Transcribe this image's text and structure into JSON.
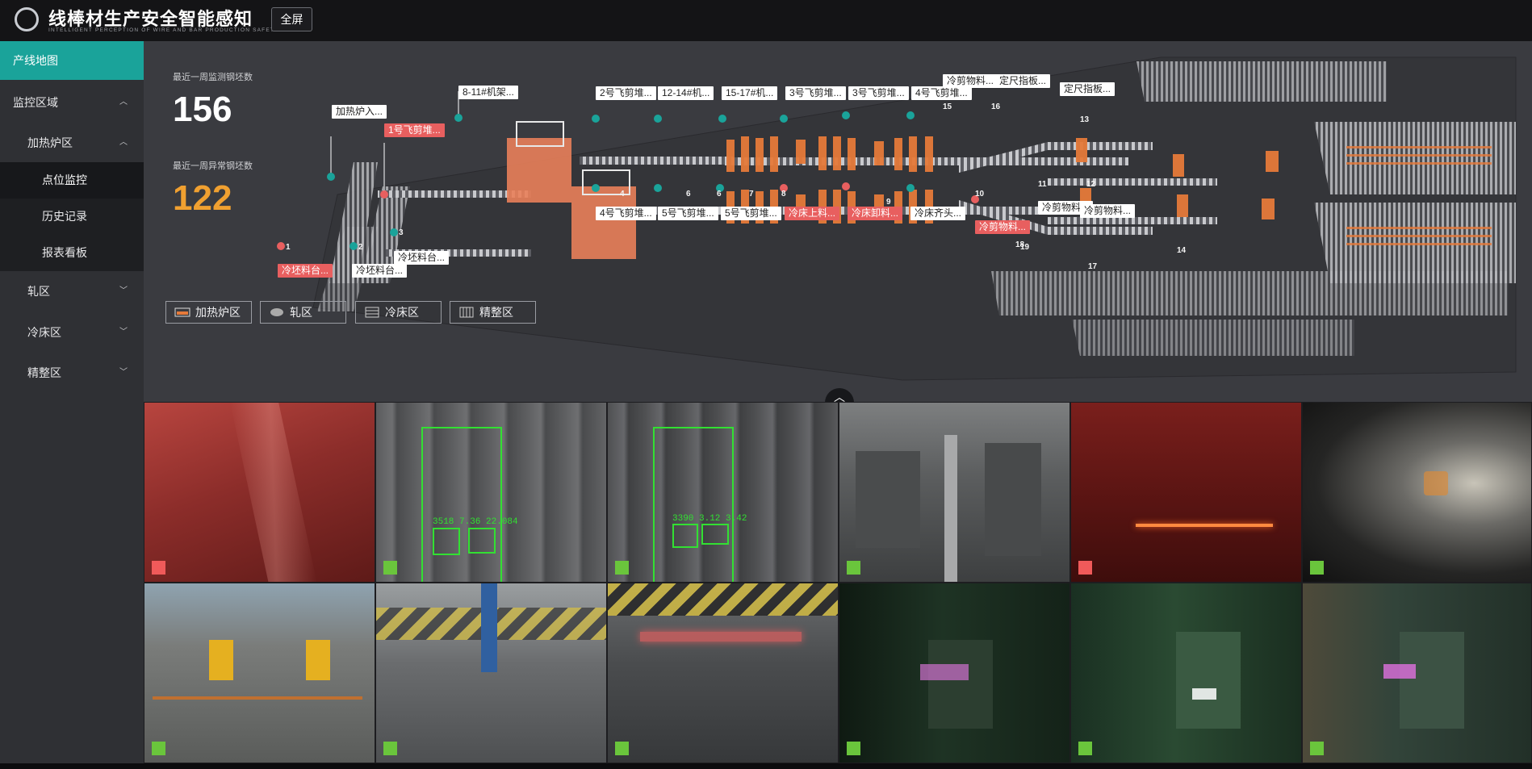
{
  "header": {
    "title": "线棒材生产安全智能感知",
    "subtitle": "INTELLIGENT PERCEPTION OF WIRE AND BAR PRODUCTION SAFETY",
    "fullscreen_label": "全屏"
  },
  "sidebar": {
    "items": [
      {
        "label": "产线地图",
        "active": true
      },
      {
        "label": "监控区域",
        "chevron": "chevron-up-icon"
      },
      {
        "label": "加热炉区",
        "chevron": "chevron-up-icon"
      },
      {
        "label": "点位监控",
        "selected": true
      },
      {
        "label": "历史记录"
      },
      {
        "label": "报表看板"
      },
      {
        "label": "轧区",
        "chevron": "chevron-down-icon"
      },
      {
        "label": "冷床区",
        "chevron": "chevron-down-icon"
      },
      {
        "label": "精整区",
        "chevron": "chevron-down-icon"
      }
    ]
  },
  "stats": {
    "weekly_monitored_label": "最近一周监测钢坯数",
    "weekly_monitored_value": "156",
    "weekly_abnormal_label": "最近一周异常钢坯数",
    "weekly_abnormal_value": "122"
  },
  "map_tags": [
    {
      "text": "加热炉入...",
      "alert": false
    },
    {
      "text": "1号飞剪堆...",
      "alert": true
    },
    {
      "text": "8-11#机架...",
      "alert": false
    },
    {
      "text": "2号飞剪堆...",
      "alert": false
    },
    {
      "text": "12-14#机...",
      "alert": false
    },
    {
      "text": "15-17#机...",
      "alert": false
    },
    {
      "text": "3号飞剪堆...",
      "alert": false
    },
    {
      "text": "3号飞剪堆...",
      "alert": false
    },
    {
      "text": "4号飞剪堆...",
      "alert": false
    },
    {
      "text": "冷剪物料...",
      "alert": false
    },
    {
      "text": "定尺指板...",
      "alert": false
    },
    {
      "text": "定尺指板...",
      "alert": false
    },
    {
      "text": "4号飞剪堆...",
      "alert": false
    },
    {
      "text": "5号飞剪堆...",
      "alert": false
    },
    {
      "text": "5号飞剪堆...",
      "alert": false
    },
    {
      "text": "冷床上料...",
      "alert": true
    },
    {
      "text": "冷床卸料...",
      "alert": true
    },
    {
      "text": "冷床齐头...",
      "alert": false
    },
    {
      "text": "冷剪物料...",
      "alert": true
    },
    {
      "text": "冷剪物料...",
      "alert": false
    },
    {
      "text": "冷剪物料...",
      "alert": false
    },
    {
      "text": "冷坯料台...",
      "alert": false
    },
    {
      "text": "冷坯料台...",
      "alert": true
    },
    {
      "text": "冷坯料台...",
      "alert": false
    }
  ],
  "marker_numbers": [
    "1",
    "2",
    "3",
    "4",
    "6",
    "6",
    "7",
    "8",
    "9",
    "10",
    "11",
    "12",
    "13",
    "14",
    "15",
    "16",
    "17",
    "18",
    "19"
  ],
  "area_buttons": [
    {
      "label": "加热炉区",
      "icon": "furnace-icon"
    },
    {
      "label": "轧区",
      "icon": "roller-icon"
    },
    {
      "label": "冷床区",
      "icon": "cooling-bed-icon"
    },
    {
      "label": "精整区",
      "icon": "finishing-icon"
    }
  ],
  "cameras": [
    {
      "status": "alarm",
      "overlay": ""
    },
    {
      "status": "normal",
      "overlay": "3518 7.36 22.084"
    },
    {
      "status": "normal",
      "overlay": "3390 3.12 3.42"
    },
    {
      "status": "normal",
      "overlay": ""
    },
    {
      "status": "alarm",
      "overlay": ""
    },
    {
      "status": "normal",
      "overlay": ""
    },
    {
      "status": "normal",
      "overlay": ""
    },
    {
      "status": "normal",
      "overlay": ""
    },
    {
      "status": "normal",
      "overlay": ""
    },
    {
      "status": "normal",
      "overlay": ""
    },
    {
      "status": "normal",
      "overlay": ""
    },
    {
      "status": "normal",
      "overlay": ""
    }
  ],
  "colors": {
    "accent": "#1aa39a",
    "alarm": "#f05a5a",
    "normal": "#6ac53c",
    "abnormal_value": "#f0a030"
  }
}
